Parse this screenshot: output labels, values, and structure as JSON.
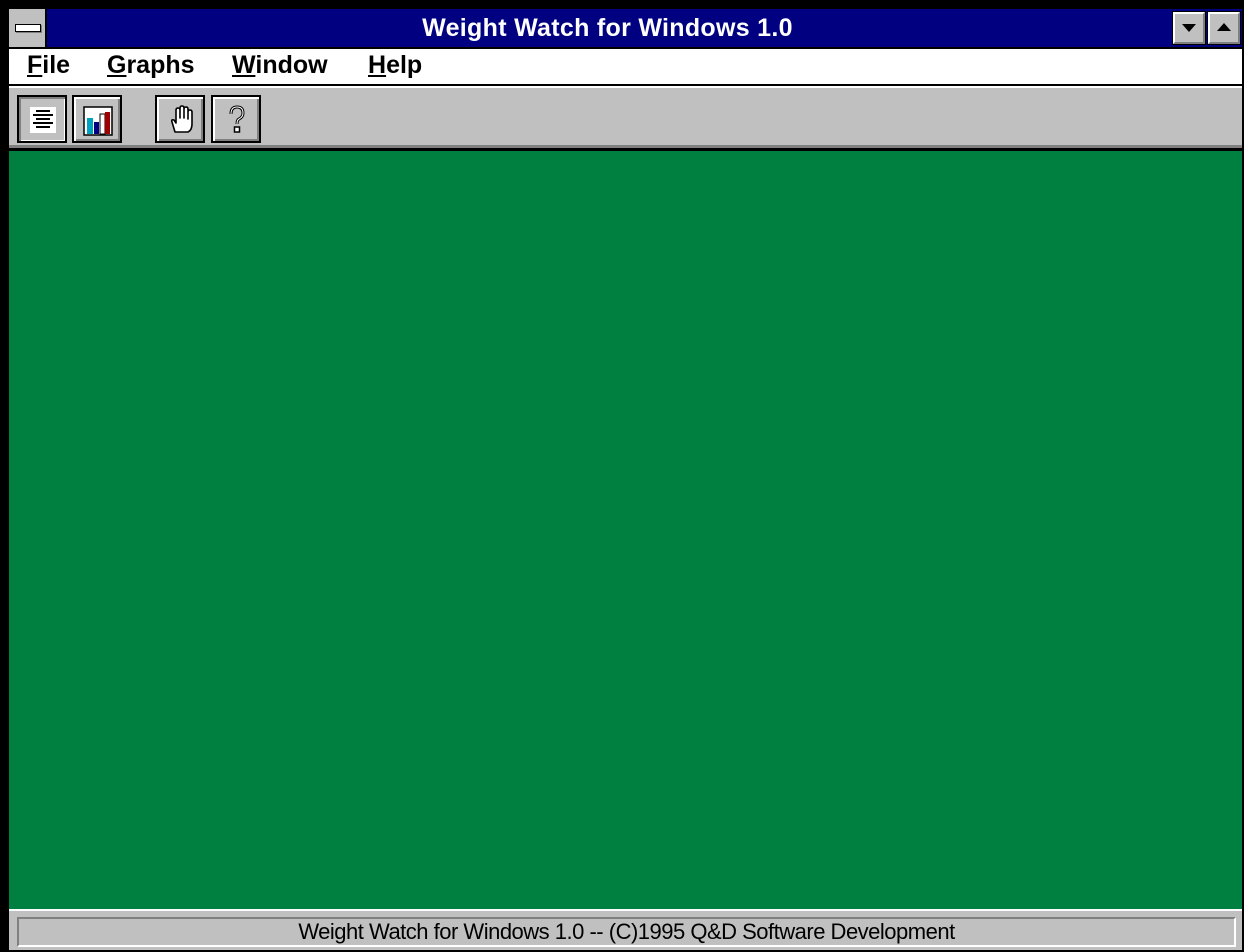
{
  "window": {
    "title": "Weight Watch for Windows 1.0"
  },
  "menubar": {
    "items": [
      {
        "accel": "F",
        "rest": "ile"
      },
      {
        "accel": "G",
        "rest": "raphs"
      },
      {
        "accel": "W",
        "rest": "indow"
      },
      {
        "accel": "H",
        "rest": "elp"
      }
    ]
  },
  "toolbar": {
    "buttons": [
      {
        "icon": "text-lines-icon",
        "pressed": true
      },
      {
        "icon": "bar-chart-icon",
        "pressed": false
      },
      {
        "icon": "hand-icon",
        "pressed": false
      },
      {
        "icon": "question-mark-icon",
        "pressed": false
      }
    ]
  },
  "colors": {
    "title_bar": "#000080",
    "client_background": "#008040",
    "chrome": "#c0c0c0"
  },
  "status": {
    "text": "Weight Watch for Windows 1.0 -- (C)1995 Q&D Software Development"
  }
}
